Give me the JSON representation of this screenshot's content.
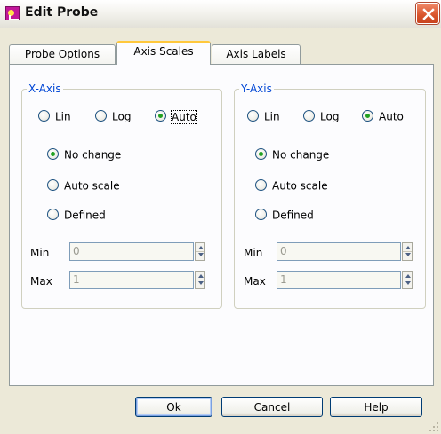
{
  "window": {
    "title": "Edit Probe"
  },
  "tabs": [
    {
      "label": "Probe Options",
      "active": false
    },
    {
      "label": "Axis Scales",
      "active": true
    },
    {
      "label": "Axis Labels",
      "active": false
    }
  ],
  "x_axis": {
    "legend": "X-Axis",
    "scale": {
      "lin_label": "Lin",
      "log_label": "Log",
      "auto_label": "Auto",
      "selected": "Auto"
    },
    "mode": {
      "no_change_label": "No change",
      "auto_scale_label": "Auto scale",
      "defined_label": "Defined",
      "selected": "No change"
    },
    "min": {
      "label": "Min",
      "value": "0"
    },
    "max": {
      "label": "Max",
      "value": "1"
    }
  },
  "y_axis": {
    "legend": "Y-Axis",
    "scale": {
      "lin_label": "Lin",
      "log_label": "Log",
      "auto_label": "Auto",
      "selected": "Auto"
    },
    "mode": {
      "no_change_label": "No change",
      "auto_scale_label": "Auto scale",
      "defined_label": "Defined",
      "selected": "No change"
    },
    "min": {
      "label": "Min",
      "value": "0"
    },
    "max": {
      "label": "Max",
      "value": "1"
    }
  },
  "buttons": {
    "ok_label": "Ok",
    "cancel_label": "Cancel",
    "help_label": "Help"
  },
  "colors": {
    "accent_tab": "#FFC83C",
    "group_legend": "#0046D5",
    "radio_checked": "#21A121",
    "close_button": "#D9542C"
  }
}
